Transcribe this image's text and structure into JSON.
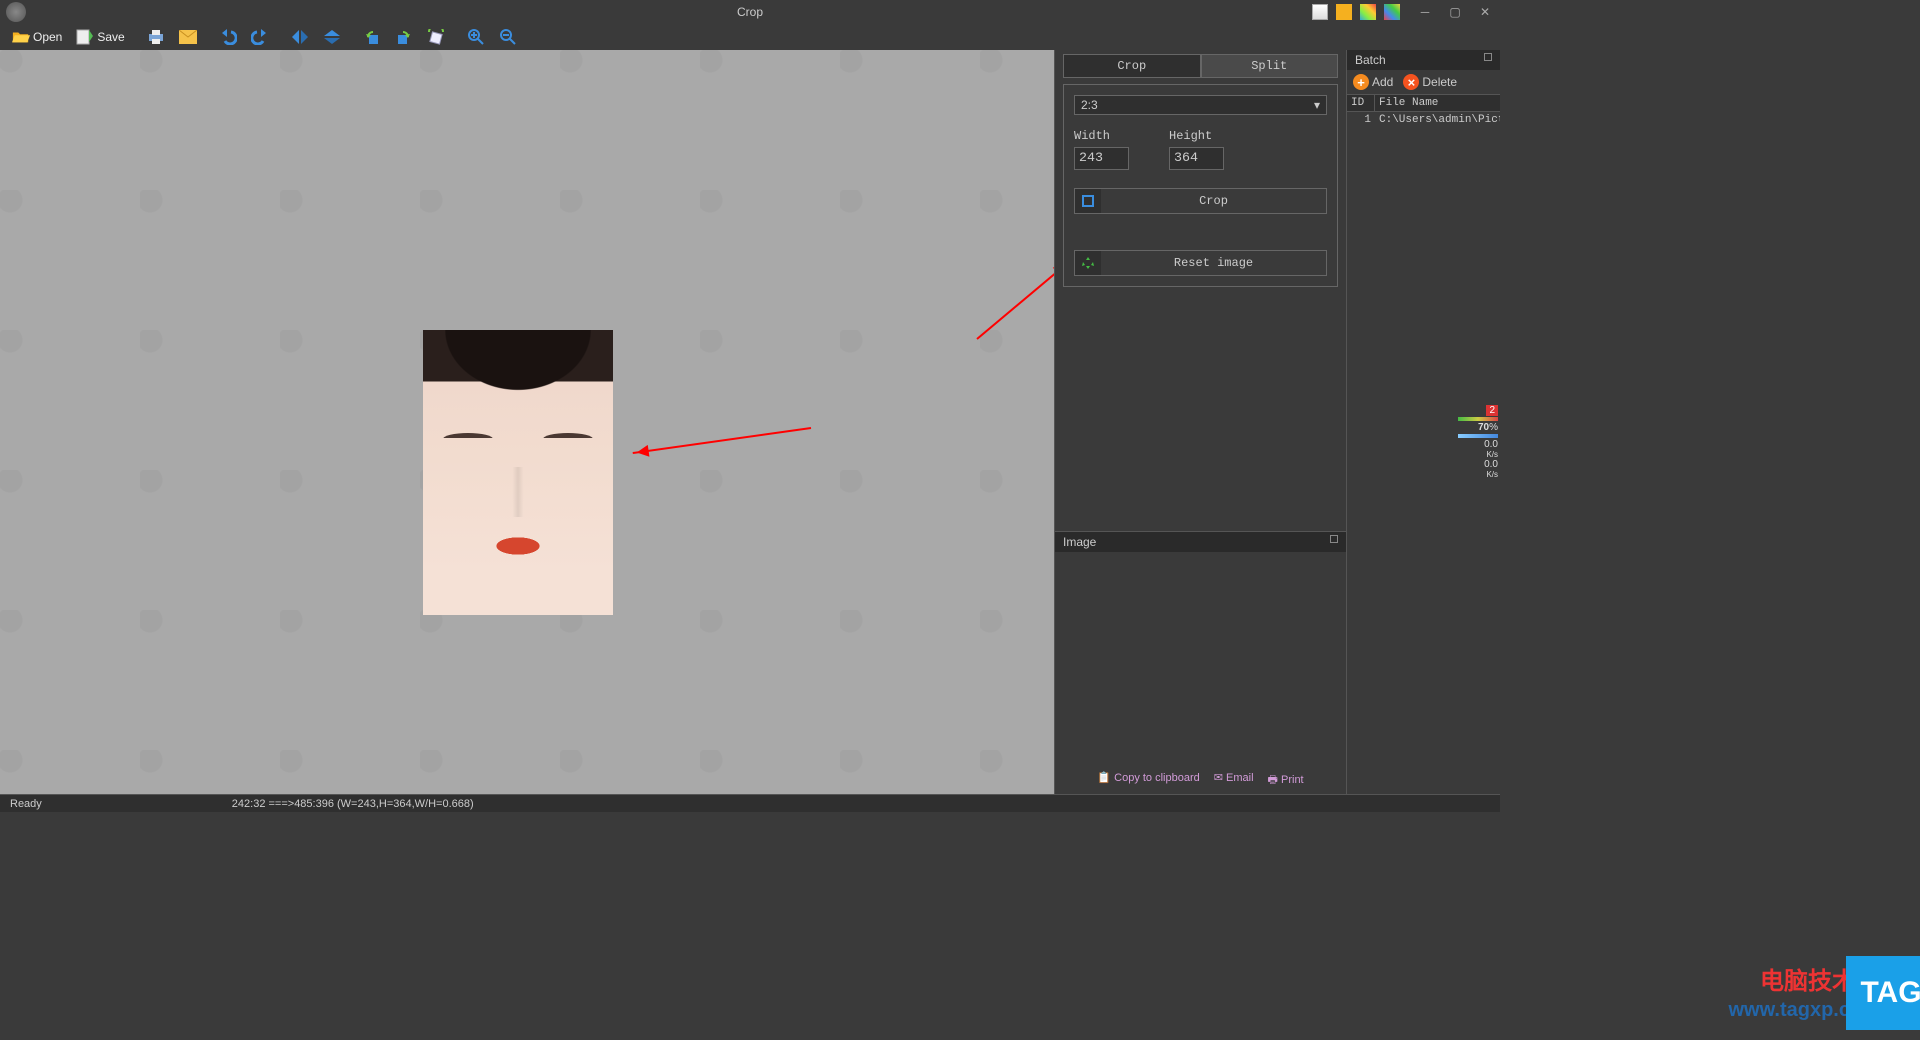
{
  "window": {
    "title": "Crop"
  },
  "toolbar": {
    "open": "Open",
    "save": "Save"
  },
  "right_panel": {
    "tabs": {
      "crop": "Crop",
      "split": "Split"
    },
    "ratio_selected": "2:3",
    "width_label": "Width",
    "height_label": "Height",
    "width_value": "243",
    "height_value": "364",
    "crop_btn": "Crop",
    "reset_btn": "Reset image"
  },
  "image_panel": {
    "header": "Image",
    "actions": {
      "copy": "Copy to clipboard",
      "email": "Email",
      "print": "Print"
    }
  },
  "batch": {
    "header": "Batch",
    "add": "Add",
    "delete": "Delete",
    "columns": {
      "id": "ID",
      "name": "File Name"
    },
    "rows": [
      {
        "id": "1",
        "name": "C:\\Users\\admin\\Picture..."
      }
    ]
  },
  "net_widget": {
    "badge": "2",
    "percent": "70",
    "up": "0.0",
    "up_unit": "K/s",
    "down": "0.0",
    "down_unit": "K/s"
  },
  "watermark": {
    "cn": "电脑技术网",
    "url": "www.tagxp.com",
    "tag": "TAG"
  },
  "statusbar": {
    "ready": "Ready",
    "coords": "242:32 ===>485:396 (W=243,H=364,W/H=0.668)"
  }
}
